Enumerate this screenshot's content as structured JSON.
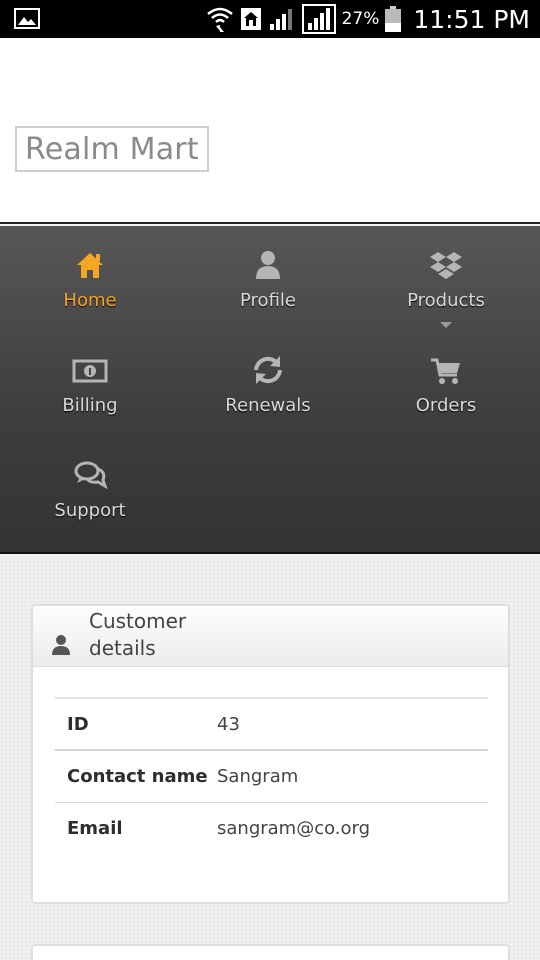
{
  "status_bar": {
    "battery_percent": "27%",
    "time": "11:51 PM",
    "icons": [
      "gallery-icon",
      "wifi-icon",
      "home-icon",
      "signal-icon",
      "signal-icon",
      "battery-icon"
    ]
  },
  "header": {
    "logo_text": "Realm Mart"
  },
  "nav": {
    "active_color": "#f5a623",
    "items": [
      {
        "label": "Home",
        "icon": "home-icon"
      },
      {
        "label": "Profile",
        "icon": "user-icon"
      },
      {
        "label": "Products",
        "icon": "dropbox-icon"
      },
      {
        "label": "Billing",
        "icon": "money-icon"
      },
      {
        "label": "Renewals",
        "icon": "refresh-icon"
      },
      {
        "label": "Orders",
        "icon": "cart-icon"
      },
      {
        "label": "Support",
        "icon": "chat-icon"
      }
    ]
  },
  "customer_panel": {
    "title": "Customer details",
    "rows": [
      {
        "key": "ID",
        "value": "43"
      },
      {
        "key": "Contact name",
        "value": "Sangram"
      },
      {
        "key": "Email",
        "value": "sangram@co.org"
      }
    ]
  }
}
